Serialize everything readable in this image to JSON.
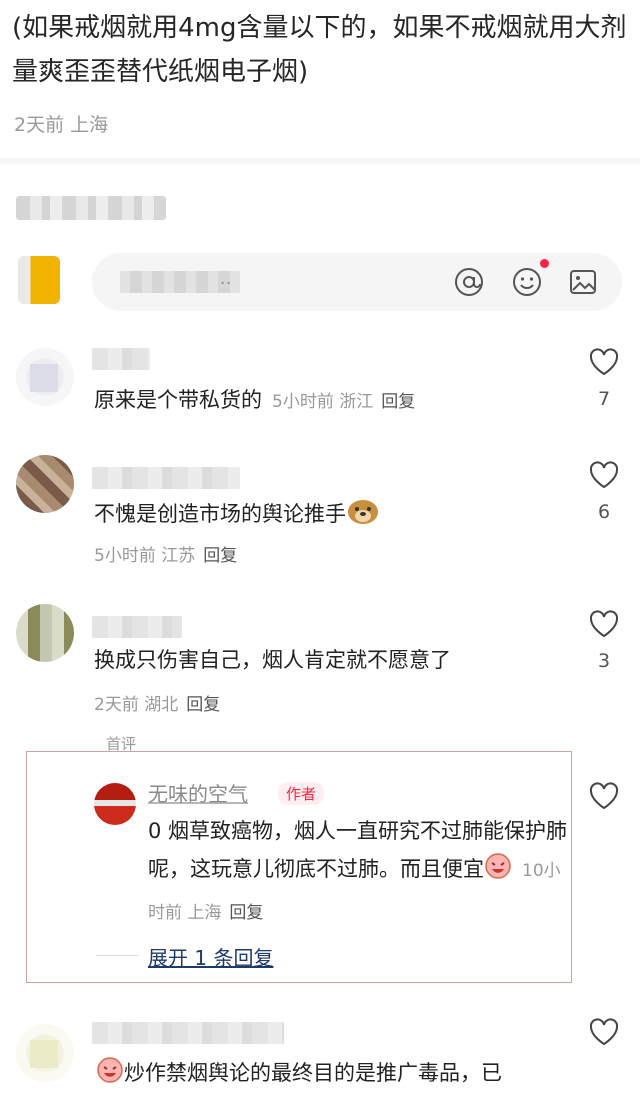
{
  "post": {
    "text": "(如果戒烟就用4mg含量以下的，如果不戒烟就用大剂量爽歪歪替代纸烟电子烟)",
    "meta": "2天前 上海"
  },
  "composer": {
    "placeholder_tail": "..",
    "icons": [
      "at-icon",
      "emoji-icon",
      "image-icon"
    ]
  },
  "comments": [
    {
      "text": "原来是个带私货的",
      "time": "5小时前",
      "location": "浙江",
      "reply_label": "回复",
      "likes": "7"
    },
    {
      "text": "不愧是创造市场的舆论推手",
      "time": "5小时前",
      "location": "江苏",
      "reply_label": "回复",
      "likes": "6"
    },
    {
      "text": "换成只伤害自己，烟人肯定就不愿意了",
      "time": "2天前",
      "location": "湖北",
      "reply_label": "回复",
      "likes": "3",
      "first_tag": "首评"
    },
    {
      "text": "炒作禁烟舆论的最终目的是推广毒品，已"
    }
  ],
  "sub_reply": {
    "author": "无味的空气",
    "author_tag": "作者",
    "text": "0 烟草致癌物，烟人一直研究不过肺能保护肺呢，这玩意儿彻底不过肺。而且便宜",
    "time": "10小时前",
    "location": "上海",
    "reply_label": "回复",
    "expand": "展开 1 条回复"
  },
  "colors": {
    "accent": "#ff2442",
    "link": "#1e3a6b",
    "muted": "#999999"
  }
}
